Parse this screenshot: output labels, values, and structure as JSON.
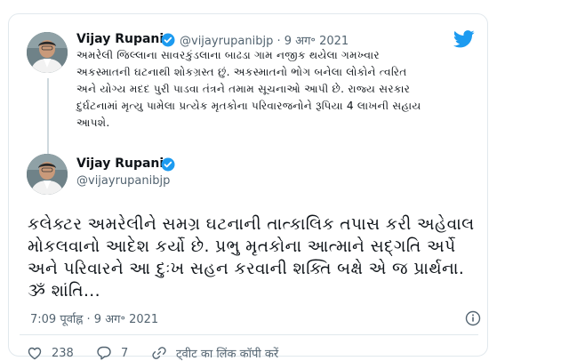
{
  "quoted_tweet": {
    "author_name": "Vijay Rupani",
    "handle": "@vijayrupanibjp",
    "date": "· 9 अग॰ 2021",
    "text": "અમરેલી જિલ્લાના સાવરકુંડલાના બાઢડા ગામ નજીક થયેલા ગમખ્વાર\nઅકસ્માતની ઘટનાથી શોકગ્રસ્ત છું. અકસ્માતનો ભોગ બનેલા લોકોને ત્વરિત\nઅને યોગ્ય મદદ પુરી પાડવા તંત્રને તમામ સૂચનાઓ આપી છે. રાજ્ય સરકાર\nદુર્ઘટનામાં મૃત્યુ પામેલા પ્રત્યેક મૃતકોના પરિવારજનોને રૂપિયા 4 લાખની સહાય\nઆપશે."
  },
  "main_tweet": {
    "author_name": "Vijay Rupani",
    "handle": "@vijayrupanibjp",
    "text": "કલેક્ટર અમરેલીને સમગ્ર ઘટનાની તાત્કાલિક તપાસ કરી અહેવાલ\nમોકલવાનો આદેશ કર્યો છે. પ્રભુ મૃતકોના આત્માને સદ્ગતિ અર્પે\nઅને પરિવારને આ દુઃખ સહન કરવાની શક્તિ બક્ષે એ જ પ્રાર્થના.\nૐ શાંતિ...",
    "timestamp": "7:09 पूर्वाह्न · 9 अग॰ 2021"
  },
  "actions": {
    "likes": "238",
    "replies": "7",
    "copy_link": "ट्वीट का लिंक कॉपी करें"
  },
  "colors": {
    "twitter_blue": "#1d9bf0",
    "secondary_text": "#536471",
    "border": "#e1e8ed"
  },
  "icons": [
    "twitter-bird-icon",
    "verified-badge-icon",
    "info-icon",
    "heart-icon",
    "reply-icon",
    "link-icon"
  ]
}
